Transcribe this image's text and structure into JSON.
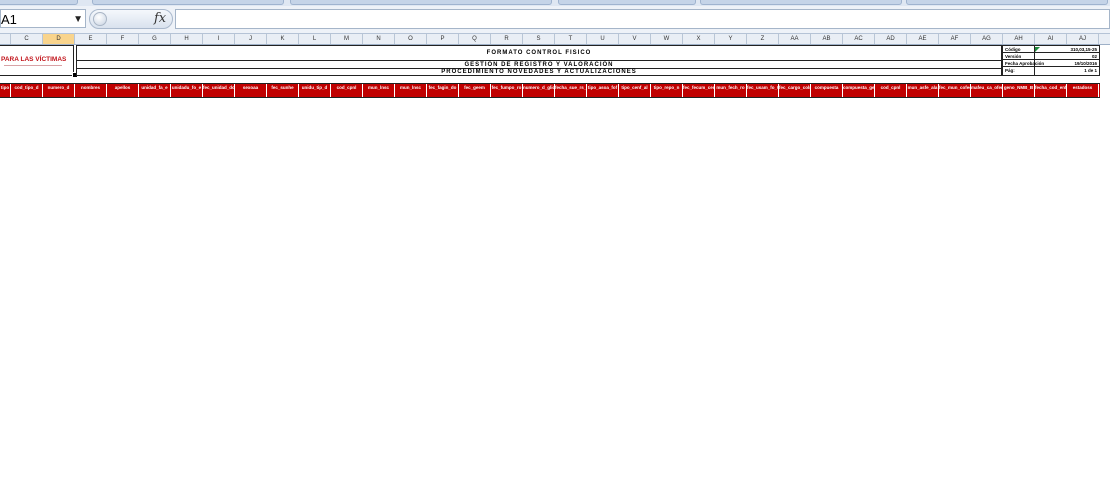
{
  "name_box": {
    "value": "A1"
  },
  "formula_bar": {
    "fx_label": "fx",
    "value": ""
  },
  "columns": [
    "C",
    "D",
    "E",
    "F",
    "G",
    "H",
    "I",
    "J",
    "K",
    "L",
    "M",
    "N",
    "O",
    "P",
    "Q",
    "R",
    "S",
    "T",
    "U",
    "V",
    "W",
    "X",
    "Y",
    "Z",
    "AA",
    "AB",
    "AC",
    "AD",
    "AE",
    "AF",
    "AG",
    "AH",
    "AI",
    "AJ"
  ],
  "selected_column": "D",
  "logo": {
    "text": "PARA LAS VÍCTIMAS"
  },
  "header": {
    "title": "FORMATO CONTROL FISICO",
    "line2": "GESTIÓN DE REGISTRO Y VALORACIÓN",
    "line3": "PROCEDIMIENTO NOVEDADES Y ACTUALIZACIONES"
  },
  "meta": [
    {
      "label": "Código",
      "value": "310,03,15-25"
    },
    {
      "label": "Versión",
      "value": "02"
    },
    {
      "label": "Fecha Aprobación",
      "value": "19/10/2016"
    },
    {
      "label": "Pág:",
      "value": "1 de 1"
    }
  ],
  "red_headers": [
    "tipo",
    "cod_tipo_d",
    "numero_d",
    "nombres",
    "apellos",
    "unidad_fa_e",
    "unidadu_fo_e",
    "fec_unidad_dos",
    "sexoaa",
    "fec_sunhe",
    "unidu_tip_d",
    "cod_cpnl",
    "mun_lnsc",
    "mun_lnsc",
    "fec_fagin_do",
    "fec_geem",
    "fec_fumpo_ro",
    "numero_d_gliden",
    "fecha_sue_rs_cpnl",
    "tipo_asoa_fof",
    "tipo_cenf_al",
    "tipo_repo_n",
    "fec_fecum_cenb",
    "mun_fech_ro",
    "fec_usam_fo_001",
    "fec_cargo_coln",
    "compuesta",
    "compuesta_gen",
    "cod_cpnl",
    "mun_asfe_ala",
    "fec_mun_cofeda",
    "mafeu_ca_ofem_ca",
    "geno_NMB_B",
    "fecha_cod_enfe_cpnl",
    "estadoss"
  ]
}
